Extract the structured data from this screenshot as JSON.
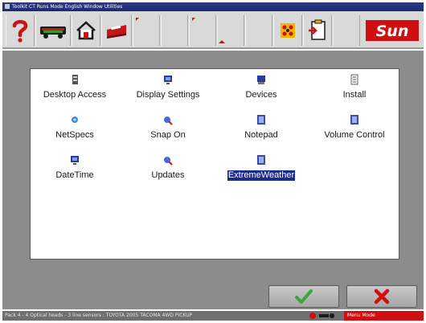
{
  "window": {
    "title": "Toolkit CT   Runs Mode   English   Window Utilities"
  },
  "toolbar": {
    "buttons": [
      {
        "name": "help",
        "icon": "question-mark-icon"
      },
      {
        "name": "vehicle-specs",
        "icon": "car-icon"
      },
      {
        "name": "home",
        "icon": "home-icon"
      },
      {
        "name": "print",
        "icon": "printer-icon"
      },
      {
        "name": "blank-1",
        "icon": ""
      },
      {
        "name": "blank-2",
        "icon": ""
      },
      {
        "name": "blank-3",
        "icon": ""
      },
      {
        "name": "blank-4",
        "icon": ""
      },
      {
        "name": "tools",
        "icon": "gear-icon"
      },
      {
        "name": "clipboard",
        "icon": "clipboard-icon"
      },
      {
        "name": "blank-5",
        "icon": ""
      },
      {
        "name": "blank-6",
        "icon": ""
      }
    ],
    "logo_text": "Sun"
  },
  "panel": {
    "items": [
      {
        "label": "Desktop Access",
        "icon": "desktop-access-icon"
      },
      {
        "label": "Display Settings",
        "icon": "monitor-icon"
      },
      {
        "label": "Devices",
        "icon": "devices-icon"
      },
      {
        "label": "Install",
        "icon": "install-icon"
      },
      {
        "label": "NetSpecs",
        "icon": "netspecs-icon"
      },
      {
        "label": "Snap On",
        "icon": "snap-on-icon"
      },
      {
        "label": "Notepad",
        "icon": "notepad-icon"
      },
      {
        "label": "Volume Control",
        "icon": "volume-icon"
      },
      {
        "label": "DateTime",
        "icon": "clock-icon"
      },
      {
        "label": "Updates",
        "icon": "updates-icon"
      },
      {
        "label": "ExtremeWeather",
        "icon": "weather-icon",
        "selected": true
      }
    ]
  },
  "actions": {
    "ok_icon": "checkmark-icon",
    "cancel_icon": "x-icon"
  },
  "status": {
    "vehicle": "Pack 4 - 4 Optical heads - 3 line sensors : TOYOTA 2005 TACOMA 4WD PICKUP",
    "mode": "Menu Mode"
  },
  "colors": {
    "titlebar": "#1c2a70",
    "selection": "#1c2a8a",
    "accent_red": "#d01010",
    "ok_green": "#3aa63a"
  }
}
